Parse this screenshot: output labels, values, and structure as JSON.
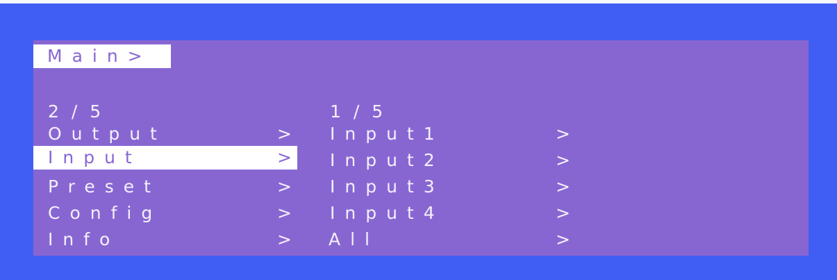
{
  "title": "Main>",
  "left_menu": {
    "page": "2 / 5",
    "items": [
      {
        "label": "Output",
        "arrow": ">"
      },
      {
        "label": "Input",
        "arrow": ">"
      },
      {
        "label": "Preset",
        "arrow": ">"
      },
      {
        "label": "Config",
        "arrow": ">"
      },
      {
        "label": "Info",
        "arrow": ">"
      }
    ],
    "selected_index": 1
  },
  "right_menu": {
    "page": "1 / 5",
    "items": [
      {
        "label": "Input1",
        "arrow": ">"
      },
      {
        "label": "Input2",
        "arrow": ">"
      },
      {
        "label": "Input3",
        "arrow": ">"
      },
      {
        "label": "Input4",
        "arrow": ">"
      },
      {
        "label": "All",
        "arrow": ">"
      }
    ]
  },
  "colors": {
    "outer_background": "#415ef4",
    "screen_background": "#8866d2",
    "text": "#f4f0fb",
    "highlight": "#ffffff"
  }
}
